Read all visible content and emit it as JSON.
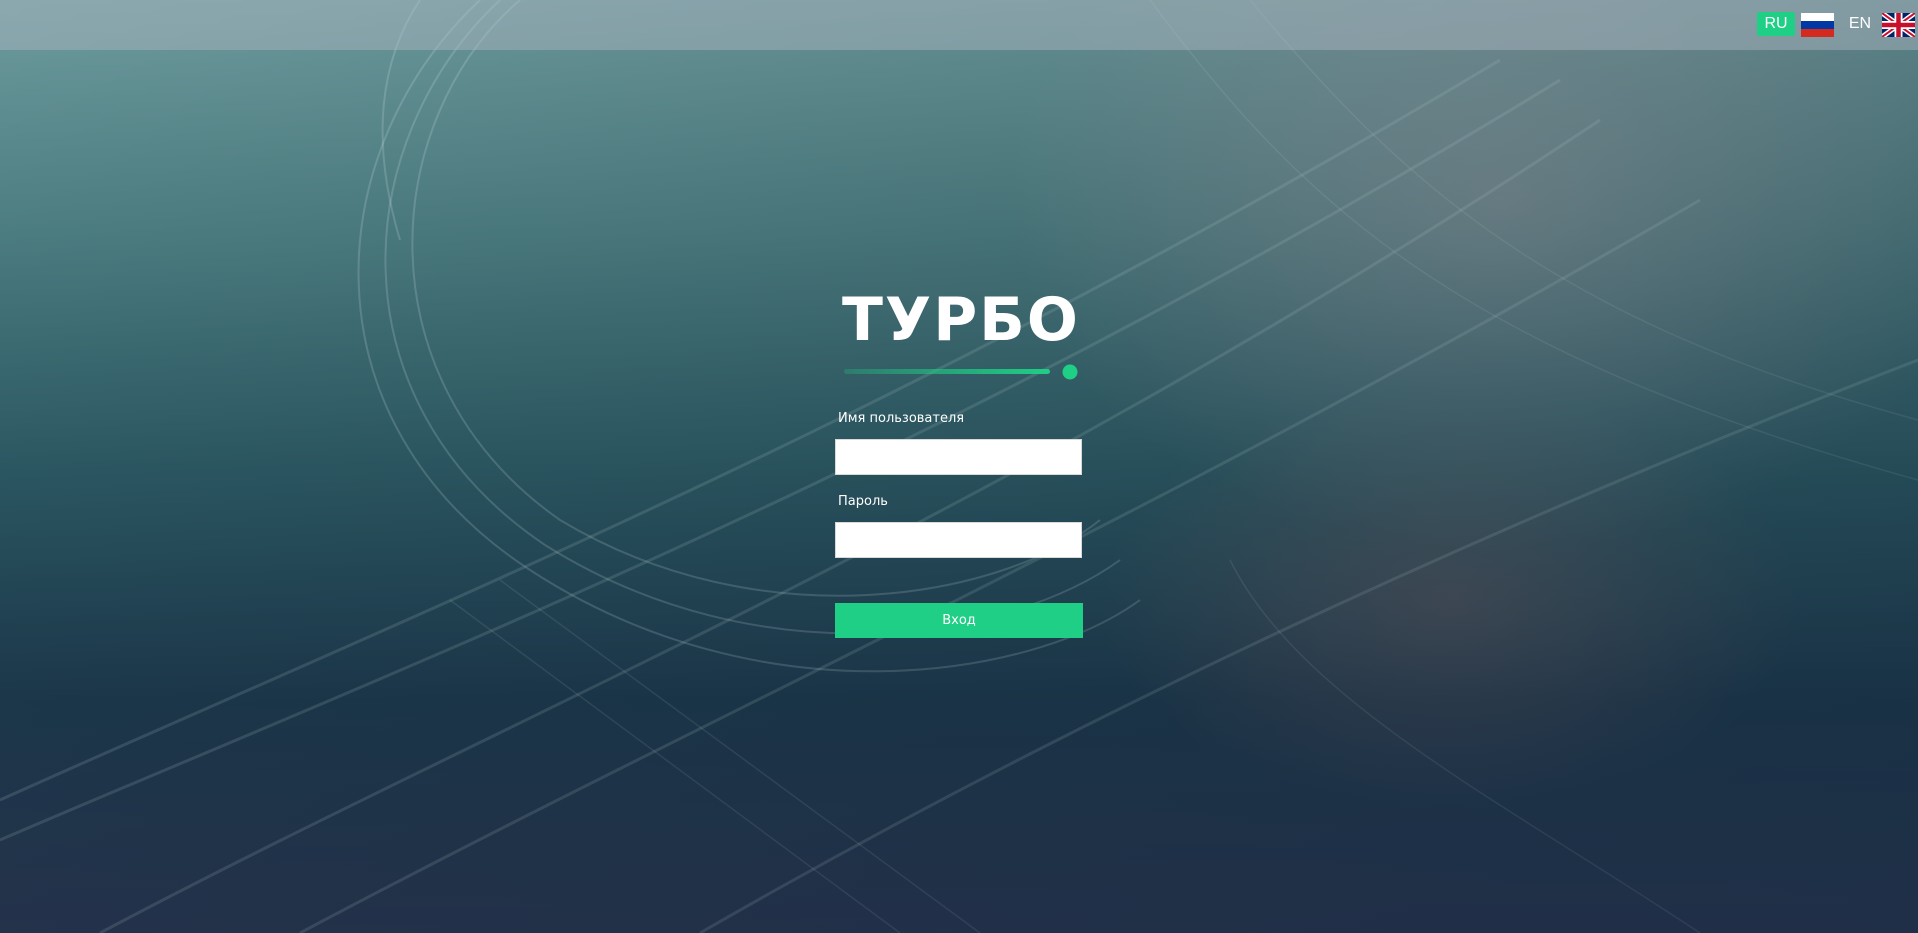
{
  "header": {
    "languages": [
      {
        "code": "RU",
        "flag_icon": "russia-flag-icon",
        "active": true,
        "accent": "#1fcf86"
      },
      {
        "code": "EN",
        "flag_icon": "uk-flag-icon",
        "active": false
      }
    ]
  },
  "logo": {
    "text": "ТУРБО",
    "accent": "#1fcf86"
  },
  "form": {
    "username_label": "Имя пользователя",
    "username_value": "",
    "password_label": "Пароль",
    "password_value": "",
    "submit_label": "Вход"
  },
  "colors": {
    "accent": "#1fcf86",
    "text": "#ffffff"
  }
}
